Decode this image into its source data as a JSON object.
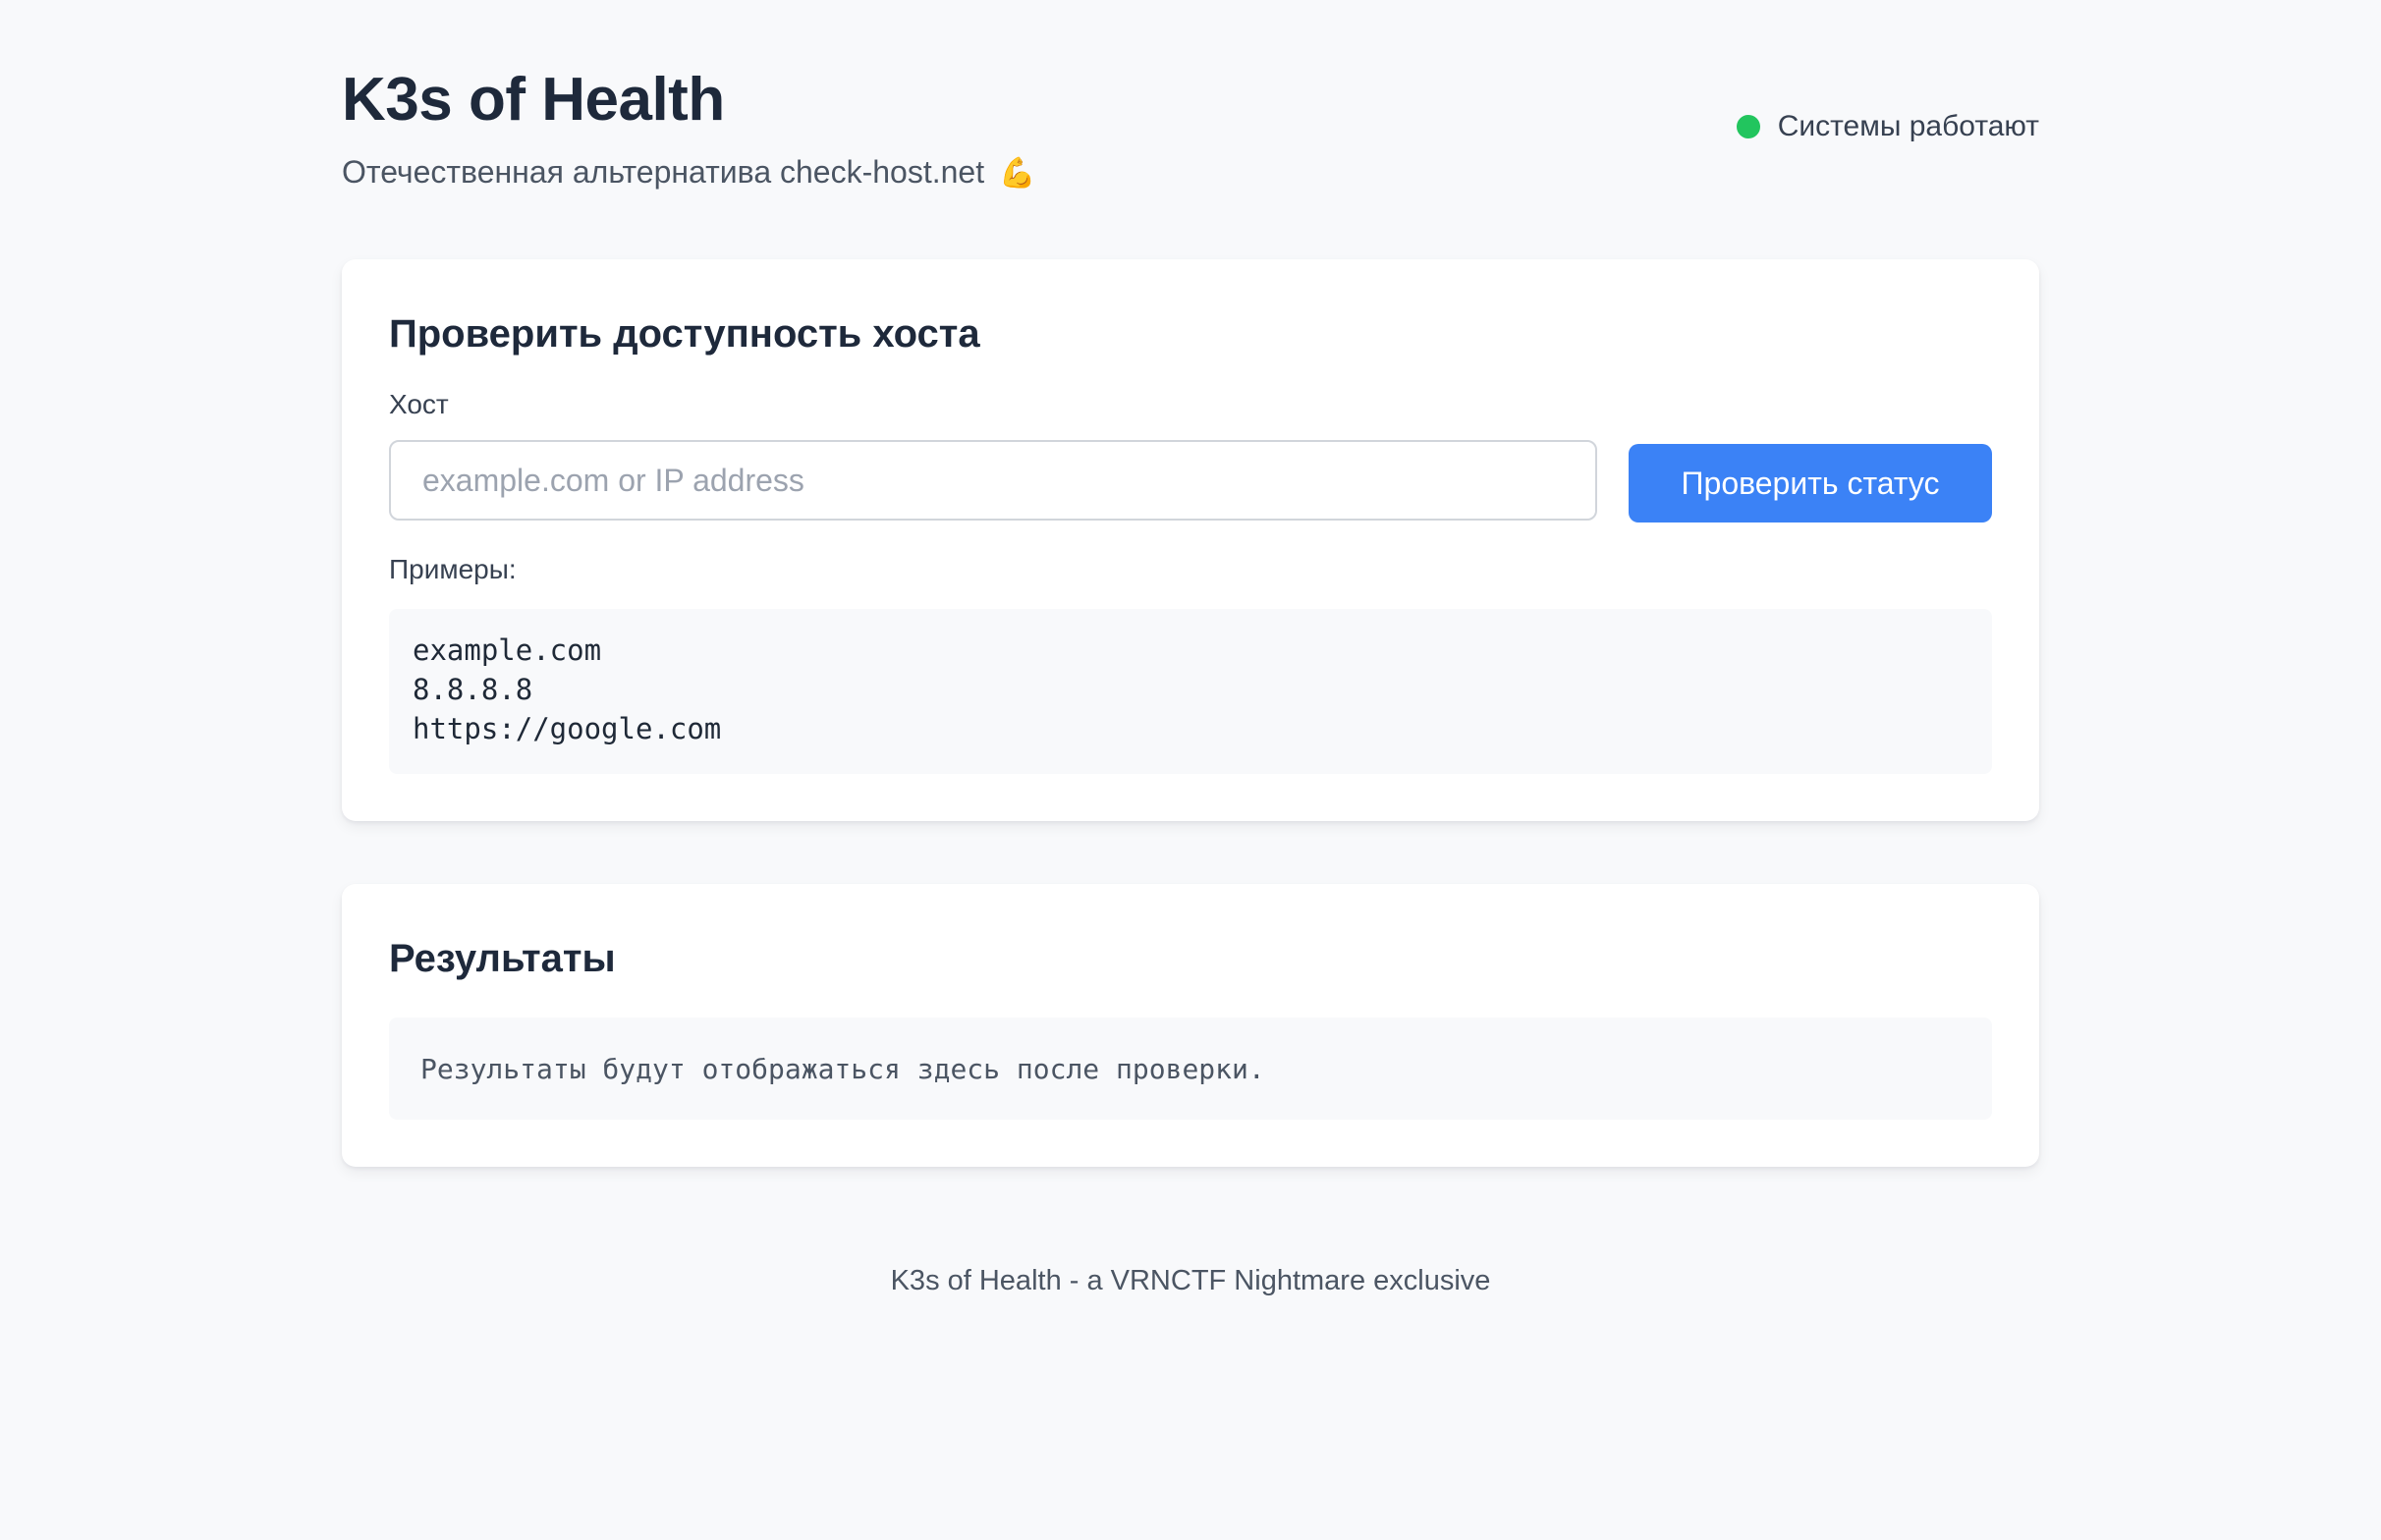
{
  "header": {
    "title": "K3s of Health",
    "subtitle": "Отечественная альтернатива check-host.net",
    "subtitle_emoji": "💪",
    "status_text": "Системы работают",
    "status_color": "#22c55e"
  },
  "check_card": {
    "title": "Проверить доступность хоста",
    "host_label": "Хост",
    "host_placeholder": "example.com or IP address",
    "host_value": "",
    "submit_label": "Проверить статус",
    "examples_label": "Примеры:",
    "examples": [
      "example.com",
      "8.8.8.8",
      "https://google.com"
    ]
  },
  "results_card": {
    "title": "Результаты",
    "placeholder_text": "Результаты будут отображаться здесь после проверки."
  },
  "footer": {
    "text": "K3s of Health - a VRNCTF Nightmare exclusive"
  },
  "colors": {
    "accent": "#3b82f6",
    "background": "#f8f9fb",
    "status_ok": "#22c55e"
  }
}
